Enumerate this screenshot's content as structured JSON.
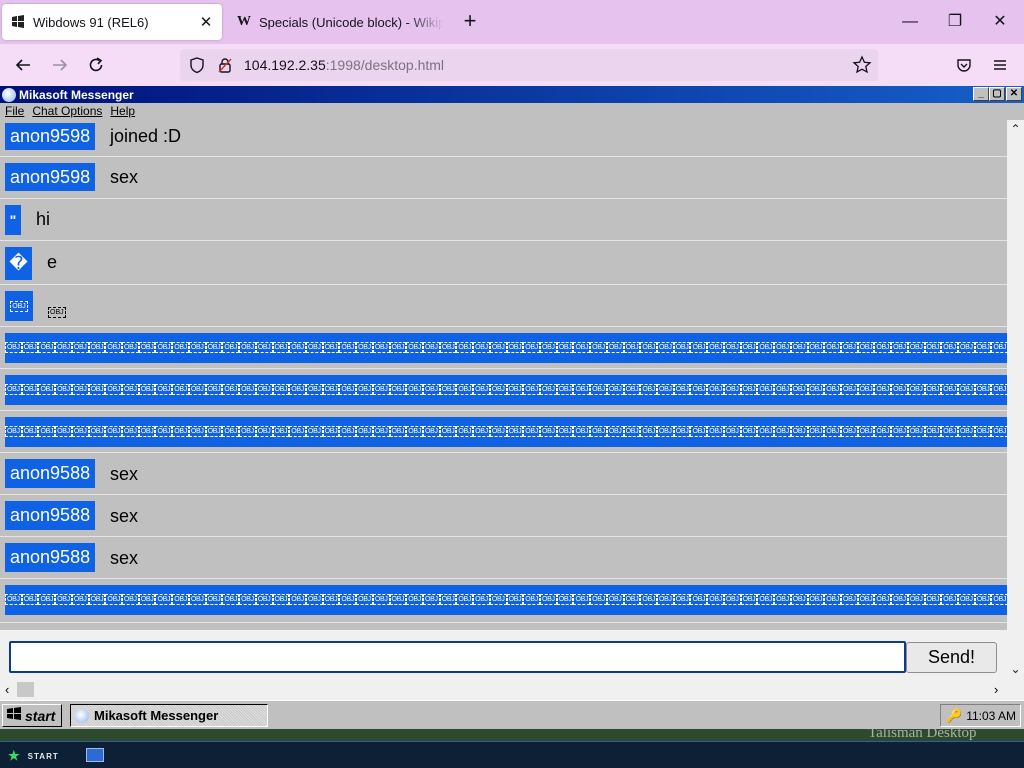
{
  "browser": {
    "tabs": [
      {
        "label": "Wibdows 91 (REL6)",
        "active": true
      },
      {
        "label": "Specials (Unicode block) - Wikipedia",
        "active": false
      }
    ],
    "url": {
      "host": "104.192.2.35",
      "rest": ":1998/desktop.html"
    }
  },
  "window": {
    "title": "Mikasoft Messenger",
    "controls": [
      "_",
      "▢",
      "✕"
    ]
  },
  "menu": [
    "File",
    "Chat Options",
    "Help"
  ],
  "chat": {
    "messages": [
      {
        "user": "anon9598",
        "text": "joined :D"
      },
      {
        "user": "anon9598",
        "text": "sex"
      },
      {
        "user": "\"",
        "text": "hi"
      },
      {
        "user": "�",
        "text": "e"
      },
      {
        "user": "OBJ",
        "text": "OBJ"
      },
      {
        "spam": "OBJ"
      },
      {
        "spam": "OBJ"
      },
      {
        "spam": "OBJ"
      },
      {
        "user": "anon9588",
        "text": "sex"
      },
      {
        "user": "anon9588",
        "text": "sex"
      },
      {
        "user": "anon9588",
        "text": "sex"
      },
      {
        "spam": "OBJ"
      }
    ],
    "input_value": "",
    "send_label": "Send!"
  },
  "taskbar": {
    "start_label": "start",
    "active_item": "Mikasoft Messenger",
    "clock": "11:03 AM"
  },
  "desktop_label": "Talisman Desktop",
  "host_taskbar": {
    "start_label": "START"
  },
  "colors": {
    "username_bg": "#0f62e3",
    "titlebar": "#00107a",
    "tab_strip": "#e6c3ef"
  },
  "icons": [
    "search-icon",
    "shield-icon",
    "lock-icon",
    "star-icon",
    "pocket-icon",
    "menu-icon",
    "back-icon",
    "forward-icon",
    "reload-icon"
  ]
}
